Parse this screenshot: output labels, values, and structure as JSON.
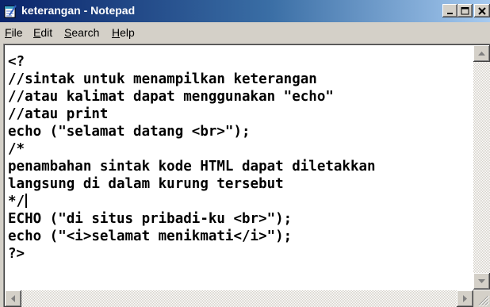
{
  "window": {
    "title": "keterangan - Notepad"
  },
  "menu": [
    {
      "pre": "",
      "u": "F",
      "post": "ile"
    },
    {
      "pre": "",
      "u": "E",
      "post": "dit"
    },
    {
      "pre": "",
      "u": "S",
      "post": "earch"
    },
    {
      "pre": "",
      "u": "H",
      "post": "elp"
    }
  ],
  "editor": {
    "lines": [
      "<?",
      "//sintak untuk menampilkan keterangan",
      "//atau kalimat dapat menggunakan \"echo\"",
      "//atau print",
      "echo (\"selamat datang <br>\");",
      "/*",
      "penambahan sintak kode HTML dapat diletakkan",
      "langsung di dalam kurung tersebut",
      "*/",
      "ECHO (\"di situs pribadi-ku <br>\");",
      "echo (\"<i>selamat menikmati</i>\");",
      "?>"
    ],
    "caret_line_index": 8
  },
  "icons": {
    "app": "notepad-icon",
    "minimize": "minimize-icon",
    "maximize": "maximize-icon",
    "close": "close-icon"
  },
  "colors": {
    "titlebar_start": "#0a246a",
    "titlebar_end": "#a6caf0",
    "chrome": "#d4d0c8"
  }
}
